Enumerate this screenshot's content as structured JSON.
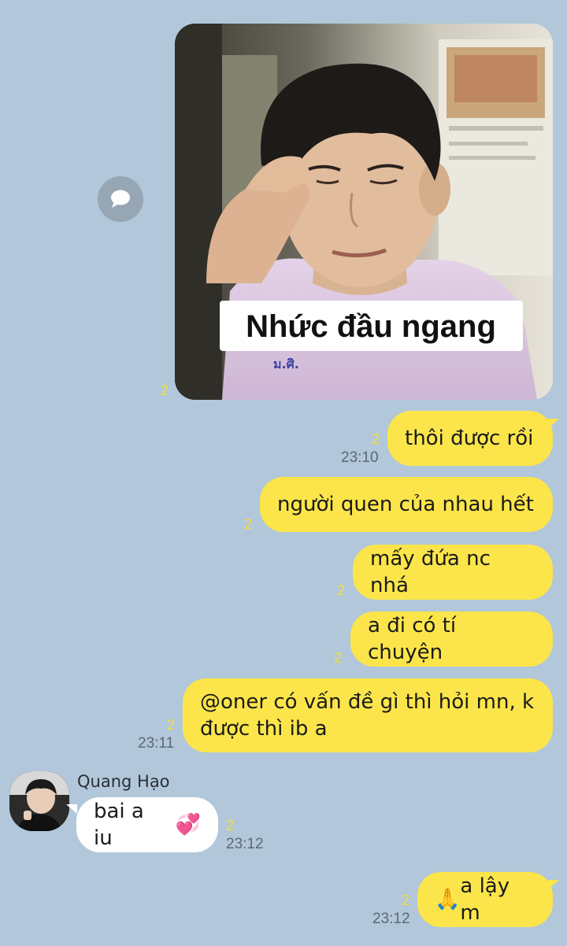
{
  "sticker": {
    "caption": "Nhức đầu ngang",
    "unread": "2",
    "badge_text": "ม.ศิ."
  },
  "messages_out": [
    {
      "text": "thôi được rồi",
      "unread": "2",
      "time": "23:10"
    },
    {
      "text": "người quen của nhau hết",
      "unread": "2",
      "time": ""
    },
    {
      "text": "mấy đứa nc nhá",
      "unread": "2",
      "time": ""
    },
    {
      "text": "a đi có tí chuyện",
      "unread": "2",
      "time": ""
    },
    {
      "line1": "@oner có vấn đề gì thì hỏi mn, k",
      "line2": "được thì ib a",
      "unread": "2",
      "time": "23:11"
    }
  ],
  "incoming": {
    "sender": "Quang Hạo",
    "text": "bai a iu",
    "emoji": "💞",
    "unread": "2",
    "time": "23:12"
  },
  "last_out": {
    "emoji": "🙏",
    "text": "a lậy m",
    "unread": "2",
    "time": "23:12"
  },
  "colors": {
    "background": "#b2c7da",
    "outgoing_bubble": "#fbe54a",
    "incoming_bubble": "#ffffff",
    "unread_count": "#f6dc3a"
  },
  "icons": {
    "share": "chat-bubble-icon"
  }
}
